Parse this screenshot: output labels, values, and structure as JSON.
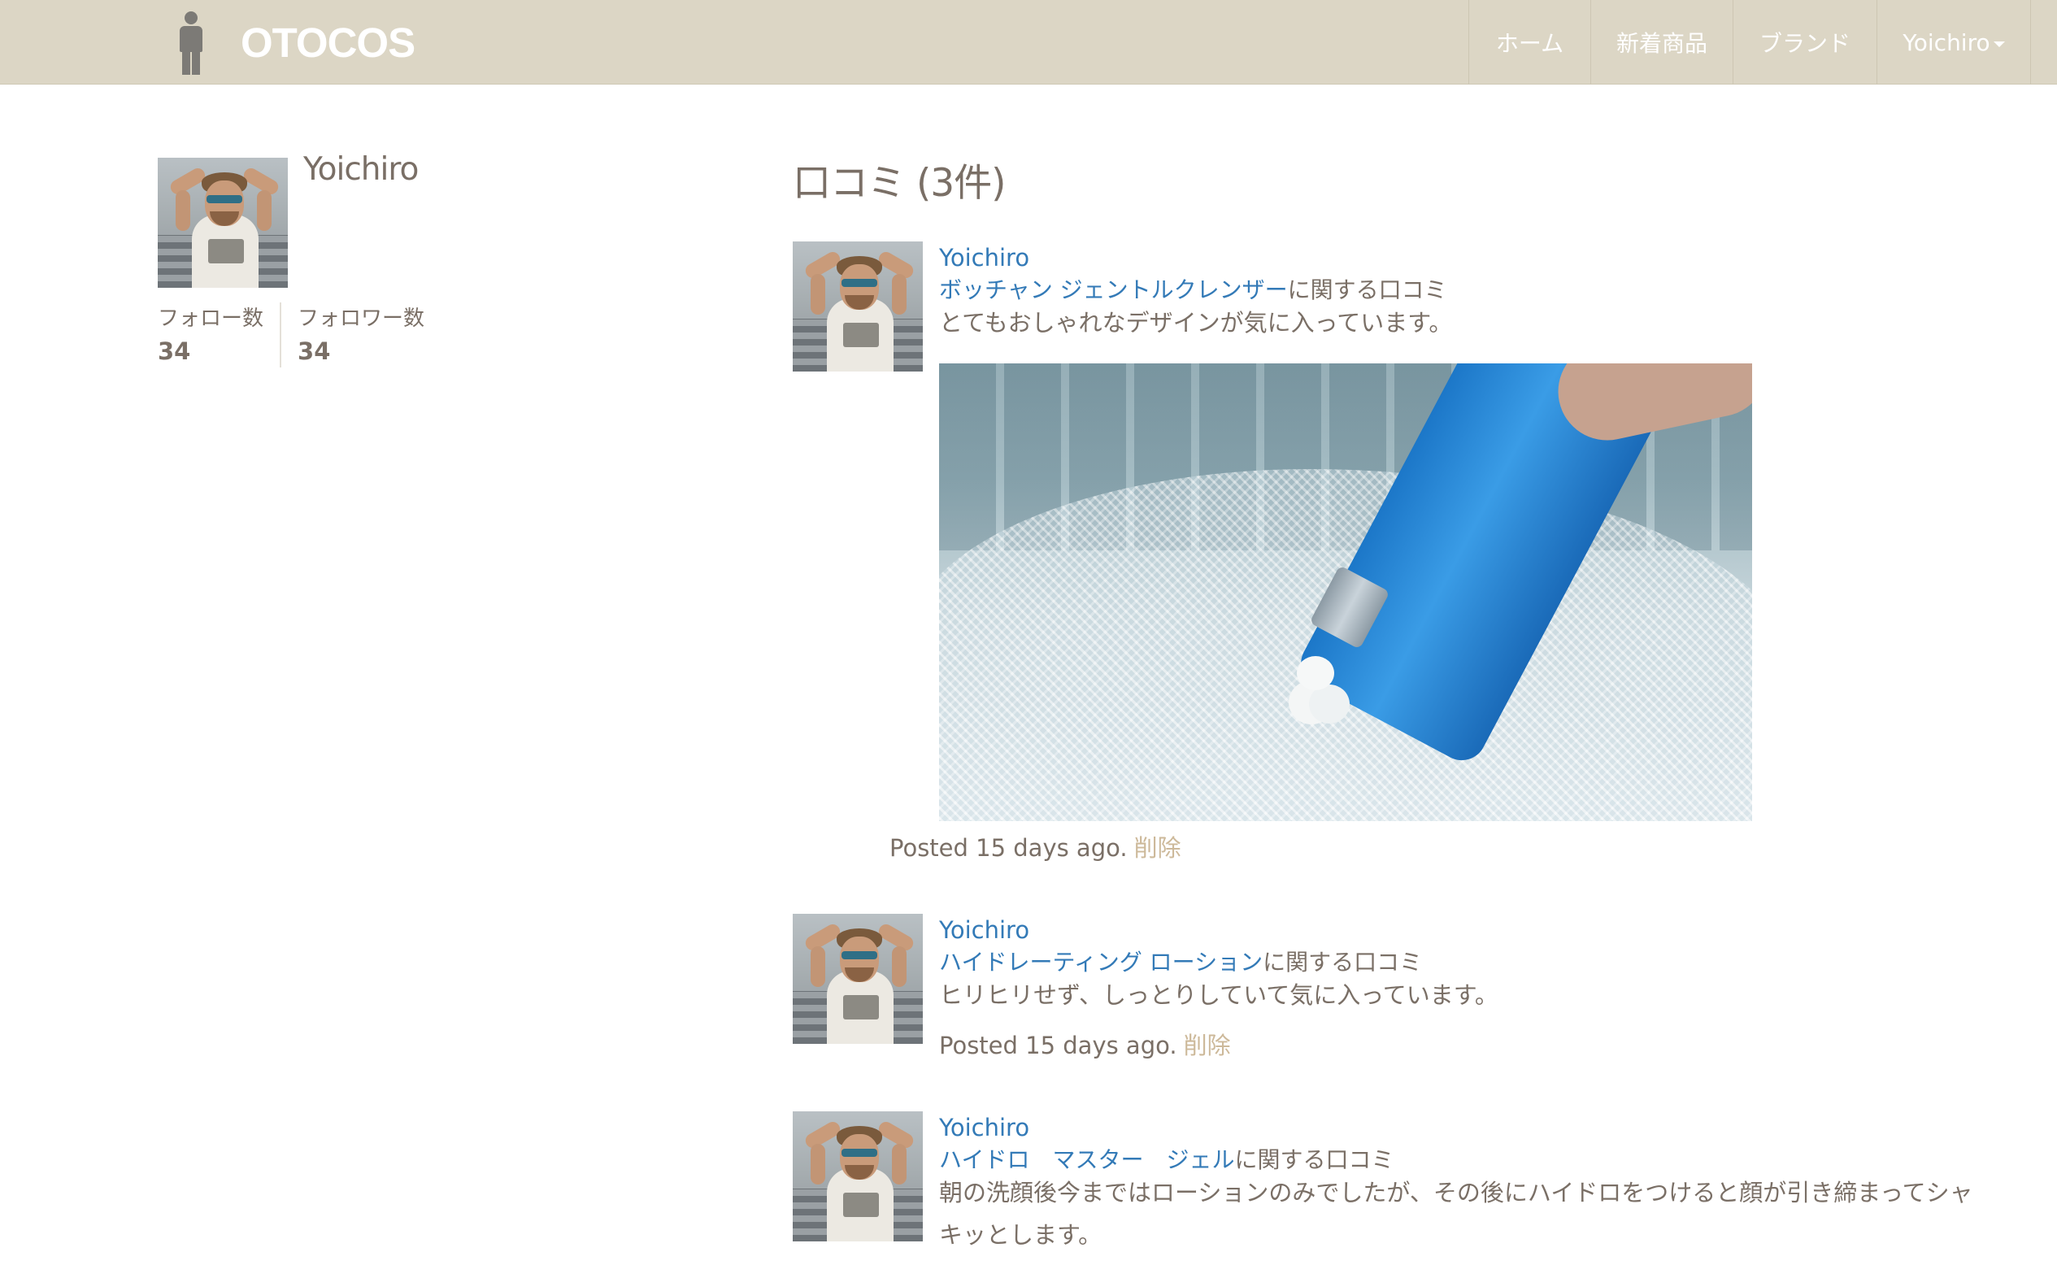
{
  "navbar": {
    "brand": "OTOCOS",
    "logo_icon": "person-icon",
    "items": [
      {
        "label": "ホーム"
      },
      {
        "label": "新着商品"
      },
      {
        "label": "ブランド"
      },
      {
        "label": "Yoichiro"
      }
    ]
  },
  "profile": {
    "name": "Yoichiro",
    "following_label": "フォロー数",
    "following_count": "34",
    "followers_label": "フォロワー数",
    "followers_count": "34"
  },
  "reviews_section": {
    "title": "口コミ (3件)",
    "items": [
      {
        "user": "Yoichiro",
        "product": "ボッチャン ジェントルクレンザー",
        "product_suffix": "に関する口コミ",
        "text": "とてもおしゃれなデザインが気に入っています。",
        "posted": "Posted 15 days ago.",
        "delete_label": "削除",
        "has_image": true
      },
      {
        "user": "Yoichiro",
        "product": "ハイドレーティング ローション",
        "product_suffix": "に関する口コミ",
        "text": "ヒリヒリせず、しっとりしていて気に入っています。",
        "posted": "Posted 15 days ago.",
        "delete_label": "削除",
        "has_image": false
      },
      {
        "user": "Yoichiro",
        "product": "ハイドロ　マスター　ジェル",
        "product_suffix": "に関する口コミ",
        "text": "朝の洗顔後今まではローションのみでしたが、その後にハイドロをつけると顔が引き締まってシャキッとします。",
        "posted": "",
        "delete_label": "",
        "has_image": false
      }
    ]
  },
  "colors": {
    "navbar_bg": "#dcd6c5",
    "link": "#337ab7",
    "text": "#7a6f66",
    "delete": "#cdb99a"
  }
}
